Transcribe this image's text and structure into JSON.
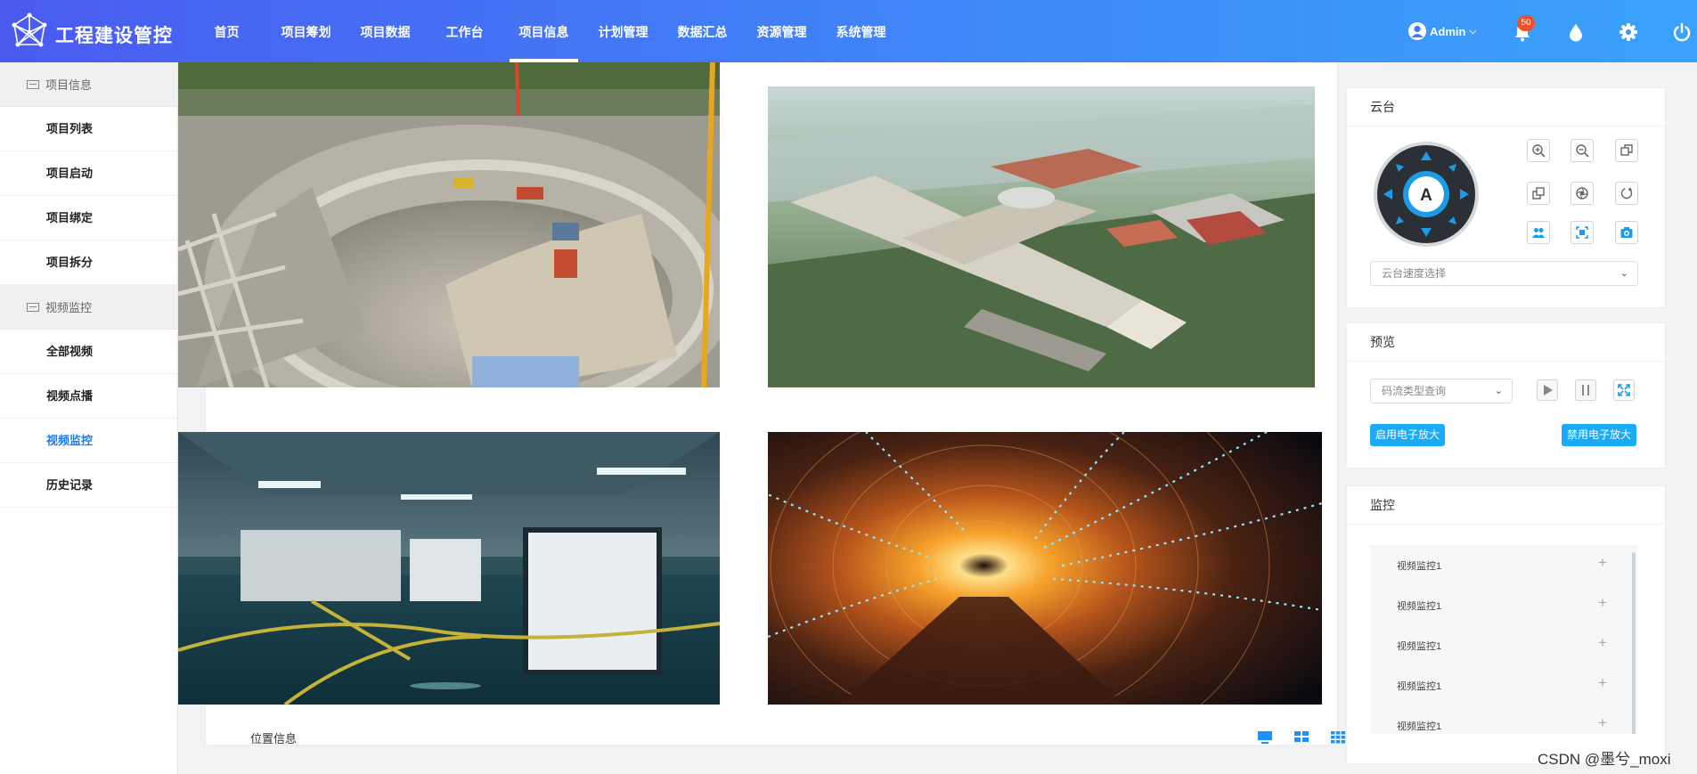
{
  "header": {
    "title": "工程建设管控",
    "nav": [
      {
        "label": "首页",
        "active": false
      },
      {
        "label": "项目筹划",
        "active": false
      },
      {
        "label": "项目数据",
        "active": false
      },
      {
        "label": "工作台",
        "active": false
      },
      {
        "label": "项目信息",
        "active": true
      },
      {
        "label": "计划管理",
        "active": false
      },
      {
        "label": "数据汇总",
        "active": false
      },
      {
        "label": "资源管理",
        "active": false
      },
      {
        "label": "系统管理",
        "active": false
      }
    ],
    "user": "Admin",
    "notification_count": "50",
    "icons": [
      "user-icon",
      "bell-icon",
      "drop-icon",
      "gear-icon",
      "power-icon"
    ]
  },
  "sidebar": {
    "groups": [
      {
        "label": "项目信息",
        "items": [
          {
            "label": "项目列表",
            "active": false
          },
          {
            "label": "项目启动",
            "active": false
          },
          {
            "label": "项目绑定",
            "active": false
          },
          {
            "label": "项目拆分",
            "active": false
          }
        ]
      },
      {
        "label": "视频监控",
        "items": [
          {
            "label": "全部视频",
            "active": false
          },
          {
            "label": "视频点播",
            "active": false
          },
          {
            "label": "视频监控",
            "active": true
          },
          {
            "label": "历史记录",
            "active": false
          }
        ]
      }
    ]
  },
  "video": {
    "location_label": "位置信息",
    "feeds": [
      "construction-site",
      "campus-aerial",
      "parking-garage",
      "light-tunnel"
    ],
    "toolbar": [
      "single-screen-icon",
      "four-screen-icon",
      "nine-screen-icon",
      "pause-icon",
      "stop-icon",
      "record-icon",
      "snapshot-icon",
      "fullscreen-icon"
    ]
  },
  "ptz": {
    "title": "云台",
    "center_label": "A",
    "speed_placeholder": "云台速度选择"
  },
  "preview": {
    "title": "预览",
    "stream_placeholder": "码流类型查询",
    "enable_zoom": "启用电子放大",
    "disable_zoom": "禁用电子放大"
  },
  "monitor": {
    "title": "监控",
    "items": [
      "视频监控1",
      "视频监控1",
      "视频监控1",
      "视频监控1",
      "视频监控1"
    ]
  },
  "watermark": "CSDN @墨兮_moxi",
  "colors": {
    "accent": "#1e7cf0",
    "button": "#19aaf8",
    "badge": "#f0502a",
    "header_start": "#4a5bf0",
    "header_end": "#3aa2fb"
  }
}
